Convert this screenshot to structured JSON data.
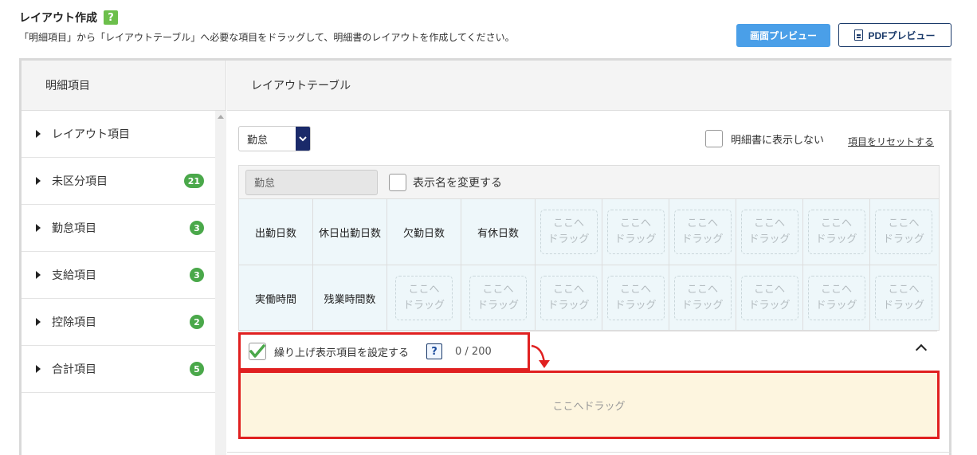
{
  "header": {
    "title": "レイアウト作成",
    "help": "?",
    "description": "「明細項目」から「レイアウトテーブル」へ必要な項目をドラッグして、明細書のレイアウトを作成してください。"
  },
  "buttons": {
    "screen_preview": "画面プレビュー",
    "pdf_preview": "PDFプレビュー"
  },
  "left_panel": {
    "heading": "明細項目",
    "items": [
      {
        "label": "レイアウト項目",
        "badge": ""
      },
      {
        "label": "未区分項目",
        "badge": "21"
      },
      {
        "label": "勤怠項目",
        "badge": "3"
      },
      {
        "label": "支給項目",
        "badge": "3"
      },
      {
        "label": "控除項目",
        "badge": "2"
      },
      {
        "label": "合計項目",
        "badge": "5"
      }
    ]
  },
  "right_panel": {
    "heading": "レイアウトテーブル",
    "select_value": "勤怠",
    "hide_label": "明細書に表示しない",
    "reset_label": "項目をリセットする",
    "name_value": "勤怠",
    "rename_label": "表示名を変更する",
    "drop_text": "ここへ\nドラッグ",
    "rows": [
      [
        "出勤日数",
        "休日出勤日数",
        "欠勤日数",
        "有休日数",
        "",
        "",
        "",
        "",
        "",
        ""
      ],
      [
        "実働時間",
        "残業時間数",
        "",
        "",
        "",
        "",
        "",
        "",
        "",
        ""
      ]
    ],
    "roundup_label": "繰り上げ表示項目を設定する",
    "roundup_help": "?",
    "roundup_count": "0 / 200",
    "dropzone_text": "ここへドラッグ"
  },
  "colors": {
    "accent_blue": "#4a9fe8",
    "navy": "#1a2a6a",
    "badge_green": "#4aa84a",
    "highlight_red": "#e02020",
    "dropzone_bg": "#fdf5df"
  }
}
